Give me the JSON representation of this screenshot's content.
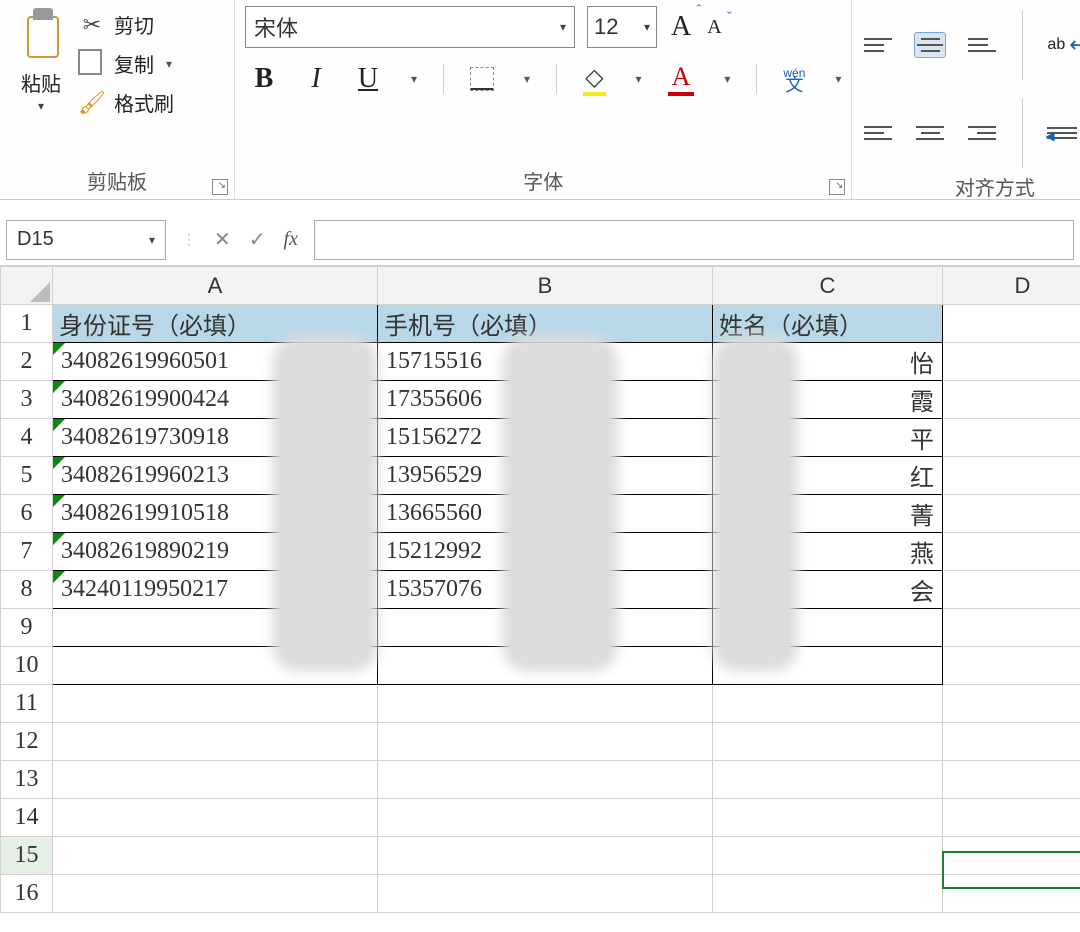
{
  "ribbon": {
    "clipboard": {
      "paste": "粘贴",
      "cut": "剪切",
      "copy": "复制",
      "format_painter": "格式刷",
      "group_label": "剪贴板"
    },
    "font": {
      "font_name": "宋体",
      "font_size": "12",
      "group_label": "字体",
      "bold": "B",
      "italic": "I",
      "underline": "U",
      "fill_glyph": "◇",
      "color_glyph": "A",
      "phonetic_top": "wén",
      "phonetic_bottom": "文"
    },
    "alignment": {
      "group_label": "对齐方式"
    }
  },
  "formula_bar": {
    "name_box": "D15",
    "fx": "fx"
  },
  "columns": [
    "A",
    "B",
    "C",
    "D"
  ],
  "headers": {
    "A": "身份证号（必填）",
    "B": "手机号（必填）",
    "C": "姓名（必填）"
  },
  "rows": [
    {
      "n": "1"
    },
    {
      "n": "2",
      "A": "34082619960501",
      "B": "15715516",
      "C": "怡"
    },
    {
      "n": "3",
      "A": "34082619900424",
      "B": "17355606",
      "C": "霞"
    },
    {
      "n": "4",
      "A": "34082619730918",
      "B": "15156272",
      "C": "平"
    },
    {
      "n": "5",
      "A": "34082619960213",
      "B": "13956529",
      "C": "红"
    },
    {
      "n": "6",
      "A": "34082619910518",
      "B": "13665560",
      "C": "菁"
    },
    {
      "n": "7",
      "A": "34082619890219",
      "B": "15212992",
      "C": "燕"
    },
    {
      "n": "8",
      "A": "34240119950217",
      "B": "15357076",
      "C": "会"
    },
    {
      "n": "9"
    },
    {
      "n": "10"
    },
    {
      "n": "11"
    },
    {
      "n": "12"
    },
    {
      "n": "13"
    },
    {
      "n": "14"
    },
    {
      "n": "15"
    },
    {
      "n": "16"
    }
  ]
}
